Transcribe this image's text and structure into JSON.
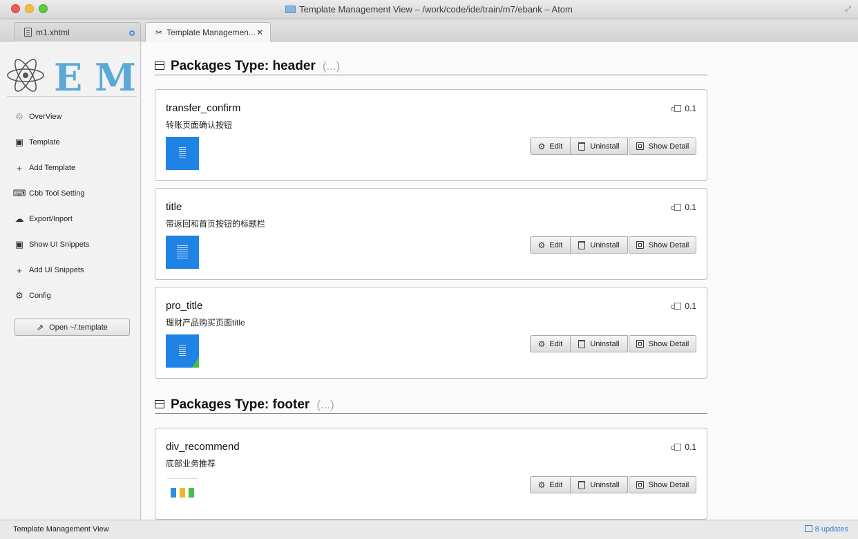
{
  "window": {
    "title": "Template Management View – /work/code/ide/train/m7/ebank – Atom"
  },
  "tabs": [
    {
      "label": "m1.xhtml",
      "icon": "file-icon",
      "modified": true,
      "active": false
    },
    {
      "label": "Template Managemen...",
      "icon": "tools-icon",
      "active": true
    }
  ],
  "sidebar": {
    "logo_text": "EMP",
    "items": [
      {
        "label": "OverView",
        "icon": "trash-can-icon"
      },
      {
        "label": "Template",
        "icon": "package-icon"
      },
      {
        "label": "Add Template",
        "icon": "plus-icon"
      },
      {
        "label": "Cbb Tool Setting",
        "icon": "keyboard-icon"
      },
      {
        "label": "Export/Inport",
        "icon": "cloud-download-icon"
      },
      {
        "label": "Show UI Snippets",
        "icon": "package-icon"
      },
      {
        "label": "Add UI Snippets",
        "icon": "plus-icon"
      },
      {
        "label": "Config",
        "icon": "gear-icon"
      }
    ],
    "open_button": "Open ~/.template"
  },
  "sections": [
    {
      "title": "Packages Type: header",
      "more": "(...)",
      "cards": [
        {
          "name": "transfer_confirm",
          "desc": "转账页面确认按钮",
          "version": "0.1"
        },
        {
          "name": "title",
          "desc": "带返回和首页按钮的标题栏",
          "version": "0.1"
        },
        {
          "name": "pro_title",
          "desc": "理财产品购买页面title",
          "version": "0.1"
        }
      ]
    },
    {
      "title": "Packages Type: footer",
      "more": "(...)",
      "cards": [
        {
          "name": "div_recommend",
          "desc": "底部业务推荐",
          "version": "0.1"
        }
      ]
    }
  ],
  "actions": {
    "edit": "Edit",
    "uninstall": "Uninstall",
    "detail": "Show Detail"
  },
  "statusbar": {
    "left": "Template Management View",
    "updates": "8 updates"
  },
  "colors": {
    "accent": "#1f82e5",
    "logo": "#5aa9d6",
    "link": "#2f7fd8"
  }
}
